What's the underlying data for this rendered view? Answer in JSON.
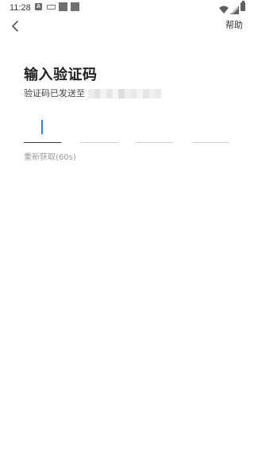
{
  "status_bar": {
    "time": "11:28",
    "notification_icons": [
      "a-badge-icon",
      "keyboard-icon",
      "app-square-icon",
      "app-square-icon"
    ],
    "right_icons": [
      "wifi-icon",
      "cellular-signal-icon",
      "battery-icon"
    ]
  },
  "header": {
    "back_icon": "chevron-left-icon",
    "help_label": "帮助"
  },
  "main": {
    "title": "输入验证码",
    "subtitle": "验证码已发送至",
    "code_inputs": [
      {
        "value": "",
        "active": true
      },
      {
        "value": "",
        "active": false
      },
      {
        "value": "",
        "active": false
      },
      {
        "value": "",
        "active": false
      }
    ],
    "resend_label": "重新获取(60s)"
  },
  "colors": {
    "caret": "#2f7df6",
    "active_underline": "#333333",
    "inactive_underline": "#cfcfcf",
    "resend_text": "#9a9a9a"
  }
}
